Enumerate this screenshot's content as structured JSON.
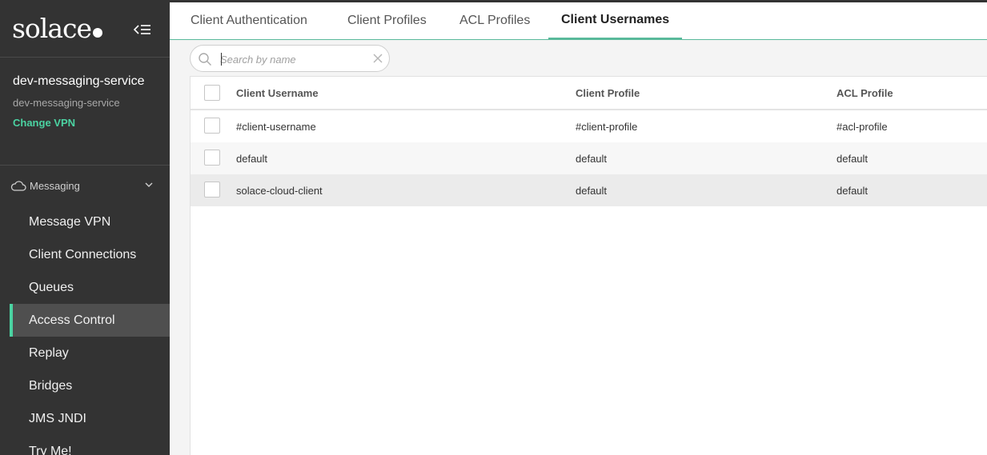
{
  "app": {
    "logo_text": "solace"
  },
  "service": {
    "name": "dev-messaging-service",
    "subtitle": "dev-messaging-service",
    "change_vpn_label": "Change VPN"
  },
  "sidebar": {
    "section_label": "Messaging",
    "items": [
      {
        "label": "Message VPN"
      },
      {
        "label": "Client Connections"
      },
      {
        "label": "Queues"
      },
      {
        "label": "Access Control"
      },
      {
        "label": "Replay"
      },
      {
        "label": "Bridges"
      },
      {
        "label": "JMS JNDI"
      },
      {
        "label": "Try Me!"
      }
    ],
    "active_index": 3
  },
  "tabs": [
    {
      "label": "Client Authentication"
    },
    {
      "label": "Client Profiles"
    },
    {
      "label": "ACL Profiles"
    },
    {
      "label": "Client Usernames"
    }
  ],
  "search": {
    "placeholder": "Search by name",
    "value": ""
  },
  "table": {
    "columns": [
      "Client Username",
      "Client Profile",
      "ACL Profile"
    ],
    "rows": [
      {
        "username": "#client-username",
        "client_profile": "#client-profile",
        "acl_profile": "#acl-profile"
      },
      {
        "username": "default",
        "client_profile": "default",
        "acl_profile": "default"
      },
      {
        "username": "solace-cloud-client",
        "client_profile": "default",
        "acl_profile": "default"
      }
    ]
  },
  "colors": {
    "accent": "#4bd3a2",
    "sidebar_bg": "#333333",
    "tab_underline": "#59b99a"
  }
}
